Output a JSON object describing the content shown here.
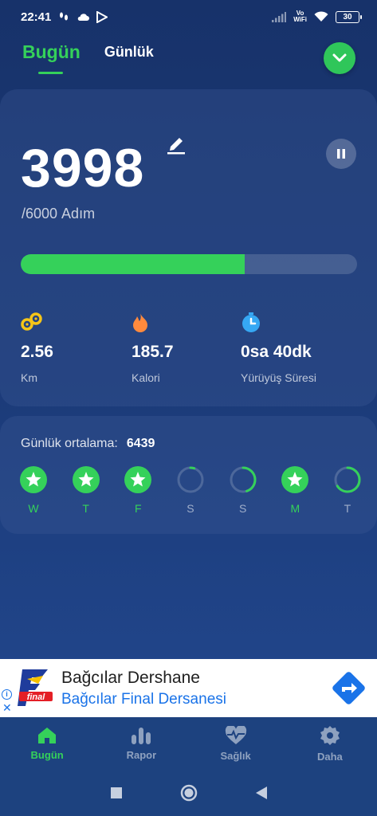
{
  "status_bar": {
    "time": "22:41",
    "battery": "30",
    "vowifi_top": "Vo",
    "vowifi_bottom": "WiFi"
  },
  "tabs": [
    {
      "label": "Bugün",
      "active": true
    },
    {
      "label": "Günlük",
      "active": false
    }
  ],
  "steps": {
    "count": "3998",
    "goal": "/6000",
    "unit": "Adım",
    "progress_fraction": 0.666
  },
  "stats": [
    {
      "value": "2.56",
      "label": "Km",
      "icon": "distance-icon",
      "color": "#f5c518"
    },
    {
      "value": "185.7",
      "label": "Kalori",
      "icon": "flame-icon",
      "color": "#ff8a3d"
    },
    {
      "value": "0sa 40dk",
      "label": "Yürüyüş Süresi",
      "icon": "timer-icon",
      "color": "#36a8f4"
    }
  ],
  "daily_average": {
    "label": "Günlük ortalama:",
    "value": "6439"
  },
  "days": [
    {
      "letter": "W",
      "done": true,
      "fraction": 1
    },
    {
      "letter": "T",
      "done": true,
      "fraction": 1
    },
    {
      "letter": "F",
      "done": true,
      "fraction": 1
    },
    {
      "letter": "S",
      "done": false,
      "fraction": 0.05
    },
    {
      "letter": "S",
      "done": false,
      "fraction": 0.45
    },
    {
      "letter": "M",
      "done": true,
      "fraction": 1
    },
    {
      "letter": "T",
      "done": false,
      "fraction": 0.66
    }
  ],
  "ad": {
    "title": "Bağcılar Dershane",
    "subtitle": "Bağcılar Final Dersanesi",
    "logo_text": "final",
    "info": "i",
    "close": "✕"
  },
  "bottom_nav": [
    {
      "label": "Bugün",
      "icon": "home-icon",
      "active": true
    },
    {
      "label": "Rapor",
      "icon": "bar-chart-icon",
      "active": false
    },
    {
      "label": "Sağlık",
      "icon": "heart-pulse-icon",
      "active": false
    },
    {
      "label": "Daha",
      "icon": "gear-icon",
      "active": false
    }
  ],
  "colors": {
    "accent_green": "#35d15a",
    "background": "#1b3a78",
    "ad_link_blue": "#1a73e8"
  }
}
